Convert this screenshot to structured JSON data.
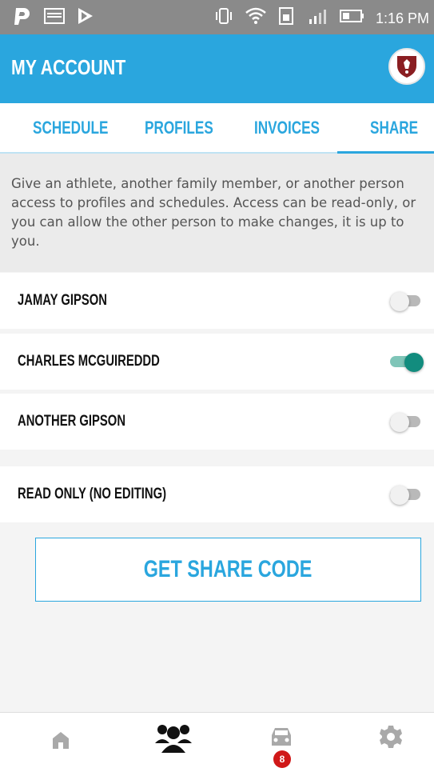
{
  "status_bar": {
    "time": "1:16 PM"
  },
  "app_bar": {
    "title": "MY ACCOUNT"
  },
  "tabs": [
    {
      "label": "SCHEDULE",
      "active": false
    },
    {
      "label": "PROFILES",
      "active": false
    },
    {
      "label": "INVOICES",
      "active": false
    },
    {
      "label": "SHARE",
      "active": true
    }
  ],
  "info_text": "Give an athlete, another family member, or another person access to profiles and schedules. Access can be read-only, or you can allow the other person to make changes, it is up to you.",
  "share_rows": [
    {
      "name": "JAMAY GIPSON",
      "enabled": false
    },
    {
      "name": "CHARLES MCGUIREDDD",
      "enabled": true
    },
    {
      "name": "ANOTHER GIPSON",
      "enabled": false
    }
  ],
  "read_only": {
    "label": "READ ONLY (NO EDITING)",
    "enabled": false
  },
  "share_button": {
    "label": "GET SHARE CODE"
  },
  "bottom_nav": {
    "items": [
      {
        "icon": "home-icon",
        "active": false
      },
      {
        "icon": "team-icon",
        "active": true
      },
      {
        "icon": "car-icon",
        "active": false,
        "badge": "8"
      },
      {
        "icon": "gear-icon",
        "active": false
      }
    ]
  },
  "colors": {
    "accent": "#2aa6de",
    "toggle_on": "#128c7e",
    "badge": "#d01818"
  }
}
